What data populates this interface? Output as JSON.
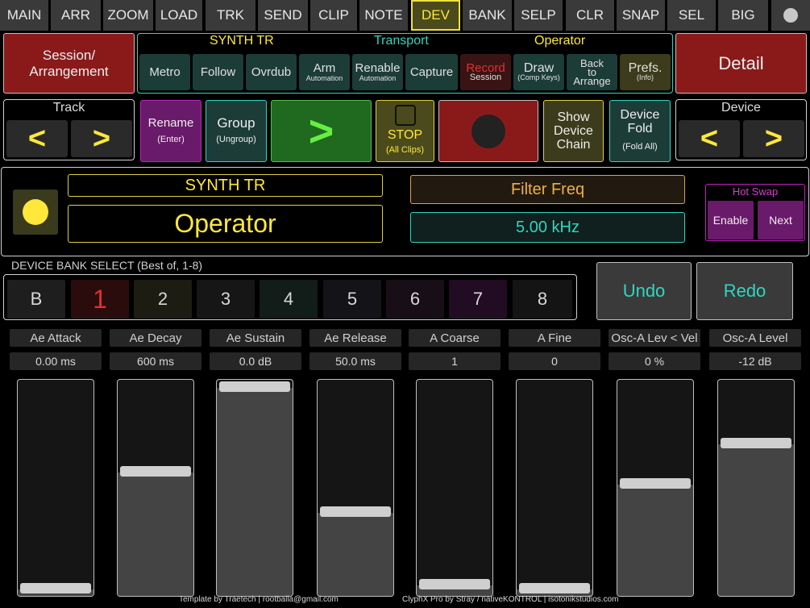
{
  "nav": {
    "tabs": [
      "MAIN",
      "ARR",
      "ZOOM",
      "LOAD",
      "TRK",
      "SEND",
      "CLIP",
      "NOTE",
      "DEV",
      "BANK",
      "SELP",
      "CLR",
      "SNAP",
      "SEL",
      "BIG"
    ],
    "active": "DEV"
  },
  "session_btn": "Session/\nArrangement",
  "detail_btn": "Detail",
  "status_bar": {
    "track": "SYNTH TR",
    "section": "Transport",
    "device": "Operator"
  },
  "transport": {
    "metro": "Metro",
    "follow": "Follow",
    "ovrdub": "Ovrdub",
    "arm": "Arm",
    "arm_sub": "Automation",
    "renable": "Renable",
    "renable_sub": "Automation",
    "capture": "Capture",
    "record": "Record",
    "record_sub": "Session",
    "draw": "Draw",
    "draw_sub": "(Comp Keys)",
    "back": "Back\nto\nArrange",
    "prefs": "Prefs.",
    "prefs_sub": "(Info)"
  },
  "track_nav": {
    "label": "Track",
    "prev": "<",
    "next": ">"
  },
  "device_nav": {
    "label": "Device",
    "prev": "<",
    "next": ">"
  },
  "actions": {
    "rename": "Rename",
    "rename_sub": "(Enter)",
    "group": "Group",
    "group_sub": "(Ungroup)",
    "play": ">",
    "stop": "STOP",
    "stop_sub": "(All Clips)",
    "show_chain": "Show\nDevice\nChain",
    "device_fold": "Device\nFold",
    "device_fold_sub": "(Fold All)"
  },
  "device_panel": {
    "track_name": "SYNTH TR",
    "device_name": "Operator",
    "param_name": "Filter Freq",
    "param_value": "5.00 kHz",
    "hot_swap": "Hot Swap",
    "enable": "Enable",
    "next": "Next"
  },
  "bank": {
    "title": "DEVICE BANK SELECT",
    "subtitle": "(Best of, 1-8)",
    "items": [
      "B",
      "1",
      "2",
      "3",
      "4",
      "5",
      "6",
      "7",
      "8"
    ],
    "selected": "1"
  },
  "undo": "Undo",
  "redo": "Redo",
  "params": [
    {
      "name": "Ae Attack",
      "value": "0.00 ms",
      "level": 0.0
    },
    {
      "name": "Ae Decay",
      "value": "600 ms",
      "level": 0.58
    },
    {
      "name": "Ae Sustain",
      "value": "0.0 dB",
      "level": 1.0
    },
    {
      "name": "Ae Release",
      "value": "50.0 ms",
      "level": 0.38
    },
    {
      "name": "A Coarse",
      "value": "1",
      "level": 0.02
    },
    {
      "name": "A Fine",
      "value": "0",
      "level": 0.0
    },
    {
      "name": "Osc-A Lev < Vel",
      "value": "0 %",
      "level": 0.52
    },
    {
      "name": "Osc-A Level",
      "value": "-12 dB",
      "level": 0.72
    }
  ],
  "footer": {
    "left": "Template by Traetech | rootballa@gmail.com",
    "right": "ClyphX Pro by Stray / nativeKONTROL |  isotonikstudios.com"
  },
  "colors": {
    "accent_yellow": "#ffe83a",
    "teal": "#2fd6c0",
    "record_red": "#e03030",
    "purple": "#c020c0"
  }
}
